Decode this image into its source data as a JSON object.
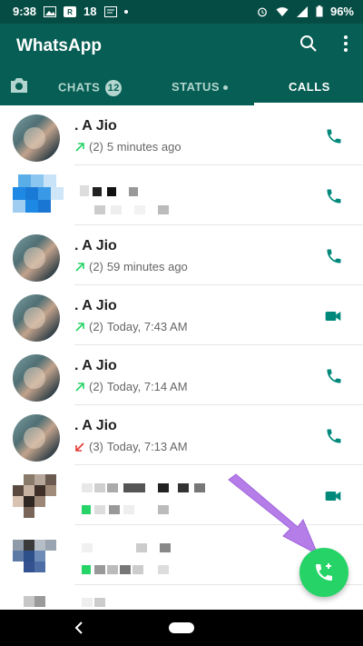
{
  "status_bar": {
    "time": "9:38",
    "notif_number": "18",
    "battery": "96%"
  },
  "app": {
    "title": "WhatsApp"
  },
  "tabs": [
    {
      "label": "",
      "icon": "camera-icon"
    },
    {
      "label": "CHATS",
      "badge": "12"
    },
    {
      "label": "STATUS"
    },
    {
      "label": "CALLS",
      "active": true
    }
  ],
  "calls": [
    {
      "name": ". A Jio",
      "direction": "outgoing",
      "count": "(2)",
      "time": "5 minutes ago",
      "call_type": "voice"
    },
    {
      "name": "",
      "direction": "",
      "count": "",
      "time": "",
      "call_type": "voice",
      "obscured": true
    },
    {
      "name": ". A Jio",
      "direction": "outgoing",
      "count": "(2)",
      "time": "59 minutes ago",
      "call_type": "voice"
    },
    {
      "name": ". A Jio",
      "direction": "outgoing",
      "count": "(2)",
      "time": "Today, 7:43 AM",
      "call_type": "video"
    },
    {
      "name": ". A Jio",
      "direction": "outgoing",
      "count": "(2)",
      "time": "Today, 7:14 AM",
      "call_type": "voice"
    },
    {
      "name": ". A Jio",
      "direction": "missed",
      "count": "(3)",
      "time": "Today, 7:13 AM",
      "call_type": "voice"
    },
    {
      "name": "",
      "direction": "",
      "count": "",
      "time": "",
      "call_type": "video",
      "obscured": true
    },
    {
      "name": "",
      "direction": "",
      "count": "",
      "time": "",
      "call_type": "voice",
      "obscured": true
    }
  ],
  "colors": {
    "teal_dark": "#054d44",
    "teal": "#075e54",
    "accent": "#25d366",
    "icon_teal": "#00897b",
    "outgoing_arrow": "#25d366",
    "missed_arrow": "#e53935"
  }
}
